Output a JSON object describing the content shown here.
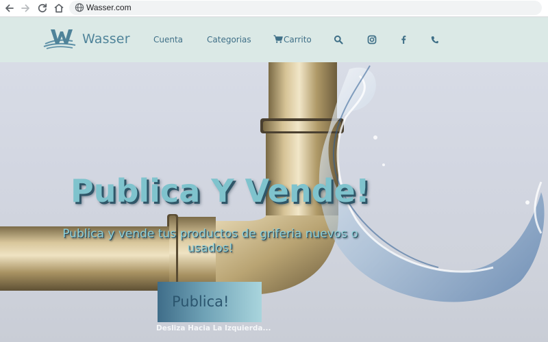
{
  "browser": {
    "url": "Wasser.com"
  },
  "header": {
    "brand": "Wasser",
    "nav": {
      "cuenta": "Cuenta",
      "categorias": "Categorias",
      "carrito": "Carrito"
    },
    "icons": [
      "search-icon",
      "instagram-icon",
      "facebook-icon",
      "phone-icon"
    ]
  },
  "hero": {
    "title": "Publica Y Vende!",
    "subtitle": "Publica y vende tus productos de griferia nuevos o usados!",
    "button_label": "Publica!",
    "hint": "Desliza Hacia La Izquierda..."
  },
  "colors": {
    "header_bg": "#dbe9e6",
    "nav_text": "#3f6f87",
    "title": "#7fc3cd",
    "button_gradient_start": "#3f6d89",
    "button_gradient_end": "#a9d5dd"
  }
}
